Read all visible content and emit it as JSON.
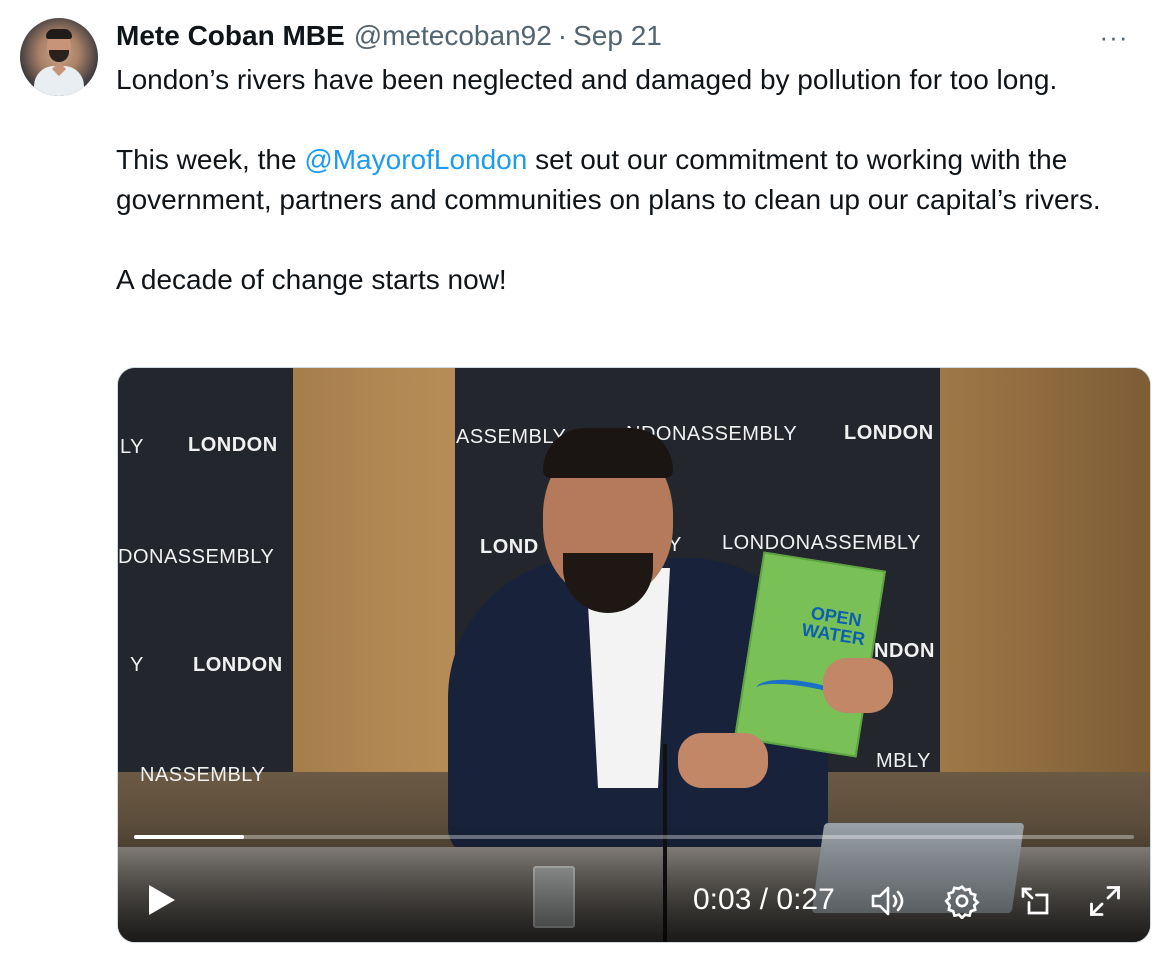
{
  "author": {
    "name": "Mete Coban MBE",
    "handle": "@metecoban92",
    "separator": "·",
    "date": "Sep 21"
  },
  "more_menu": {
    "label": "···"
  },
  "tweet": {
    "line1": "London’s rivers have been neglected and damaged by pollution for too long.",
    "line2_prefix": "This week, the ",
    "mention": "@MayorofLondon",
    "line2_suffix": " set out our commitment to working with the government, partners and communities on plans to clean up our capital’s rivers.",
    "line3": "A decade of change starts now!"
  },
  "video": {
    "backdrop_text": {
      "left_ly": "LY",
      "left_london1": "LONDON",
      "left_donassembly": "DONASSEMBLY",
      "left_y": "Y",
      "left_london2": "LONDON",
      "left_nassembly": "NASSEMBLY",
      "top_assembly": "ASSEMBLY",
      "top_ndonassembly": "NDONASSEMBLY",
      "top_london": "LONDON",
      "mid_lond": "LOND",
      "mid_y": "Y",
      "mid_londonassembly": "LONDONASSEMBLY",
      "right_ndon": "NDON",
      "right_mbly": "MBLY"
    },
    "booklet_text": "OPEN WATER",
    "time_display": "0:03 / 0:27",
    "progress_fraction": 0.11,
    "controls": {
      "play": "play-icon",
      "volume": "volume-icon",
      "settings": "settings-icon",
      "pip": "picture-in-picture-icon",
      "fullscreen": "fullscreen-icon"
    }
  },
  "colors": {
    "mention": "#1d9bf0",
    "secondary_text": "#536471",
    "primary_text": "#0f1419"
  }
}
